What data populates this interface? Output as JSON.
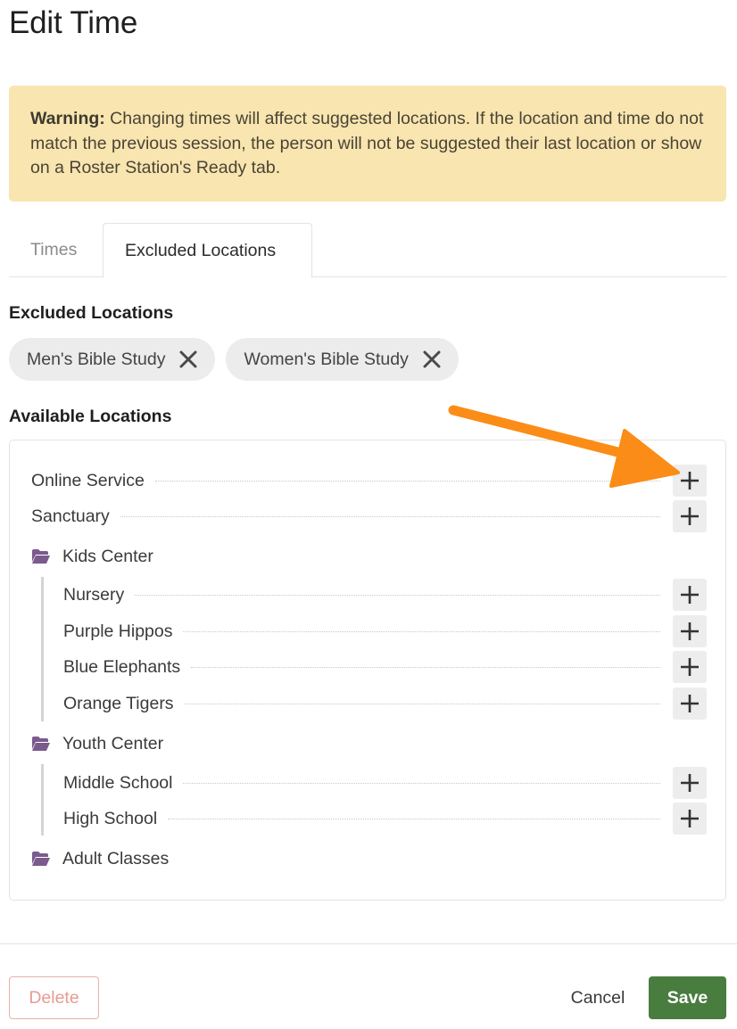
{
  "page": {
    "title": "Edit Time"
  },
  "warning": {
    "label": "Warning:",
    "text": " Changing times will affect suggested locations. If the location and time do not match the previous session, the person will not be suggested their last location or show on a Roster Station's Ready tab."
  },
  "tabs": [
    {
      "label": "Times",
      "active": false
    },
    {
      "label": "Excluded Locations",
      "active": true
    }
  ],
  "excluded": {
    "heading": "Excluded Locations",
    "chips": [
      "Men's Bible Study",
      "Women's Bible Study"
    ]
  },
  "available": {
    "heading": "Available Locations",
    "items": [
      {
        "label": "Online Service"
      },
      {
        "label": "Sanctuary"
      }
    ],
    "groups": [
      {
        "label": "Kids Center",
        "items": [
          "Nursery",
          "Purple Hippos",
          "Blue Elephants",
          "Orange Tigers"
        ]
      },
      {
        "label": "Youth Center",
        "items": [
          "Middle School",
          "High School"
        ]
      },
      {
        "label": "Adult Classes",
        "items": []
      }
    ]
  },
  "footer": {
    "delete_label": "Delete",
    "cancel_label": "Cancel",
    "save_label": "Save"
  },
  "colors": {
    "warning_bg": "#f8e5af",
    "folder_icon": "#7b5b8e",
    "save_bg": "#497c3f",
    "delete_text": "#e79c92",
    "annotation_arrow": "#fb8c17"
  },
  "icons": {
    "chip_remove": "close-icon",
    "add": "plus-icon",
    "folder": "folder-open-icon"
  }
}
